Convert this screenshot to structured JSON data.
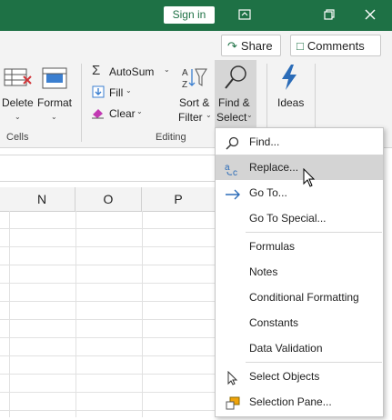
{
  "titlebar": {
    "signin": "Sign in"
  },
  "header": {
    "share": "Share",
    "comments": "Comments"
  },
  "ribbon": {
    "cells": {
      "delete": "Delete",
      "format": "Format",
      "group": "Cells"
    },
    "editing": {
      "autosum": "AutoSum",
      "fill": "Fill",
      "clear": "Clear",
      "sort_filter_1": "Sort &",
      "sort_filter_2": "Filter",
      "find_select_1": "Find &",
      "find_select_2": "Select",
      "group": "Editing"
    },
    "ideas": "Ideas"
  },
  "sheet": {
    "columns": [
      "N",
      "O",
      "P"
    ]
  },
  "menu": {
    "find": "Find...",
    "replace": "Replace...",
    "goto": "Go To...",
    "goto_special": "Go To Special...",
    "formulas": "Formulas",
    "notes": "Notes",
    "conditional": "Conditional Formatting",
    "constants": "Constants",
    "validation": "Data Validation",
    "select_objects": "Select Objects",
    "selection_pane": "Selection Pane..."
  },
  "colors": {
    "brand": "#1e7145",
    "highlight": "#d4d4d4",
    "accent_blue": "#2b6cb8"
  }
}
